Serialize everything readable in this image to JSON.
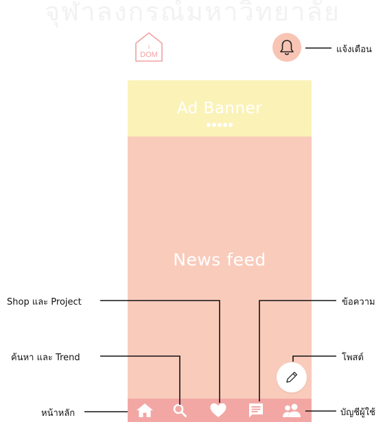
{
  "watermark": "จุฬาลงกรณ์มหาวิทยาลัย",
  "logo": {
    "text_top": "i",
    "text_bottom": "DOM"
  },
  "header": {
    "notifications_label": "แจ้งเตือน"
  },
  "ad_banner": {
    "title": "Ad Banner",
    "dot_count": 5
  },
  "feed": {
    "title": "News feed"
  },
  "callouts": {
    "shop_project": "Shop และ Project",
    "search_trend": "ค้นหา และ Trend",
    "home": "หน้าหลัก",
    "messages": "ข้อความ",
    "post": "โพสต์",
    "account": "บัญชีผู้ใช้"
  },
  "colors": {
    "ad_banner_bg": "#fbf2b8",
    "feed_bg": "#f9cbbb",
    "navbar_bg": "#f2a7a4",
    "bell_bg": "#f8c4b4",
    "logo_stroke": "#f2a0a0"
  },
  "nav_icons": [
    "home-icon",
    "search-icon",
    "heart-icon",
    "message-icon",
    "people-icon"
  ]
}
